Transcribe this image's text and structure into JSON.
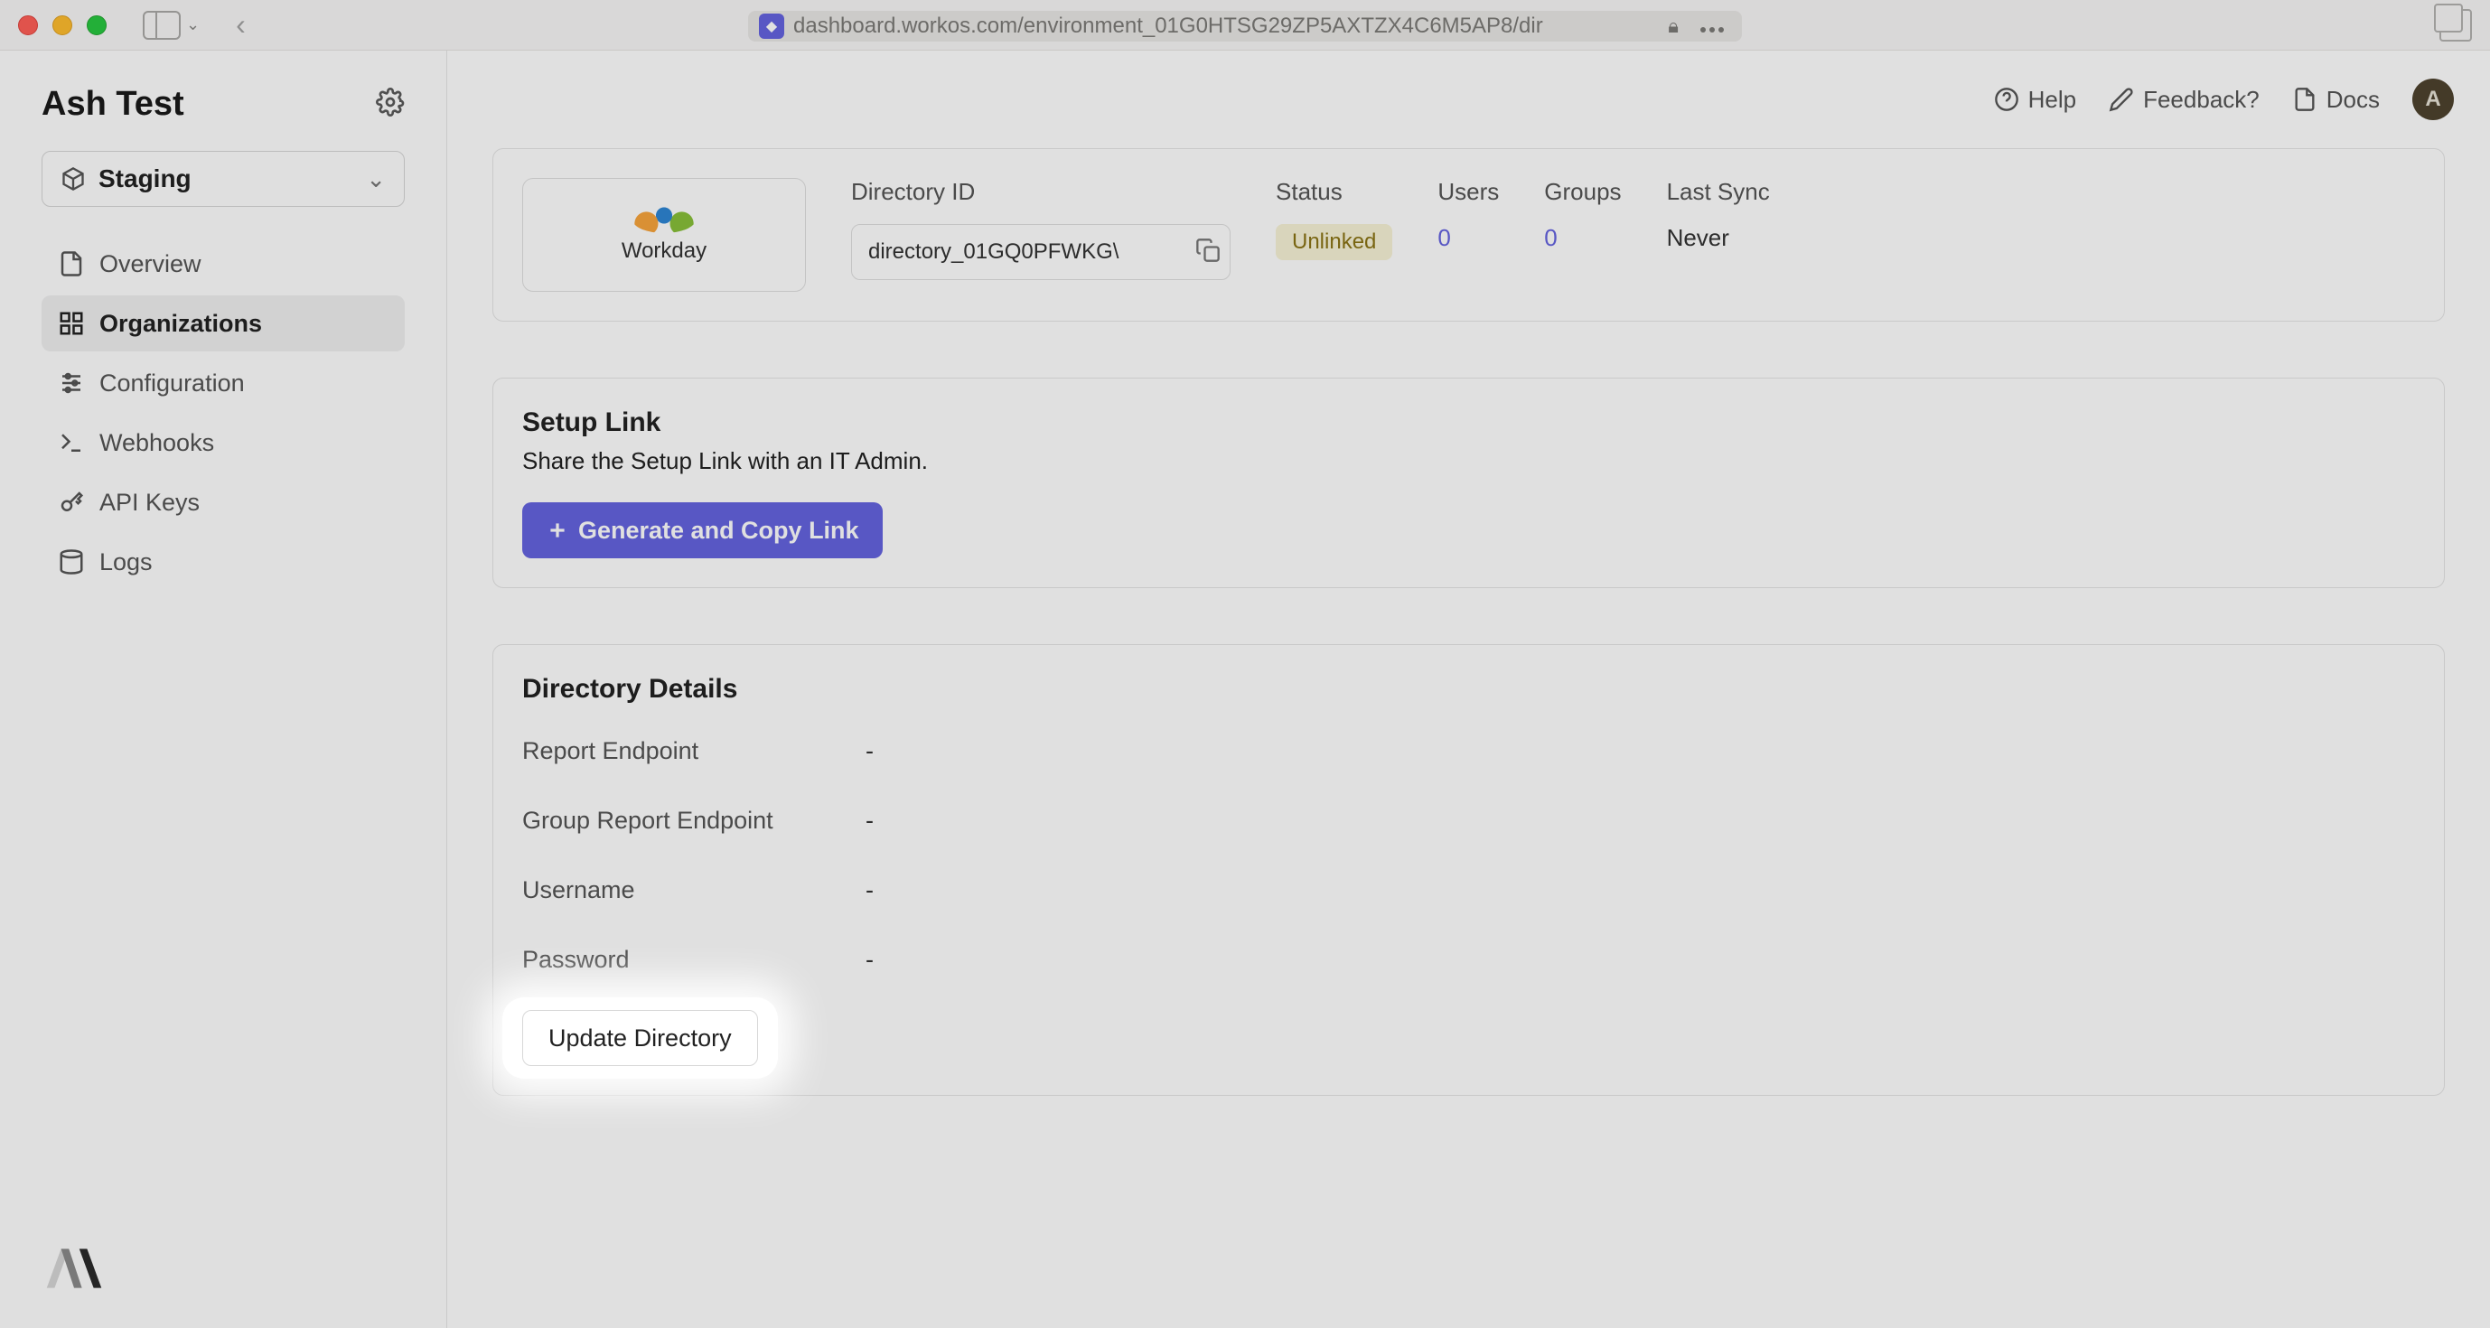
{
  "browser": {
    "url": "dashboard.workos.com/environment_01G0HTSG29ZP5AXTZX4C6M5AP8/dir"
  },
  "workspace": {
    "name": "Ash Test",
    "environment": "Staging"
  },
  "nav": {
    "overview": "Overview",
    "organizations": "Organizations",
    "configuration": "Configuration",
    "webhooks": "Webhooks",
    "api_keys": "API Keys",
    "logs": "Logs"
  },
  "topbar": {
    "help": "Help",
    "feedback": "Feedback?",
    "docs": "Docs",
    "avatar_initial": "A"
  },
  "directory": {
    "provider": "Workday",
    "id_label": "Directory ID",
    "id_value": "directory_01GQ0PFWKG\\",
    "status_label": "Status",
    "status_value": "Unlinked",
    "users_label": "Users",
    "users_value": "0",
    "groups_label": "Groups",
    "groups_value": "0",
    "last_sync_label": "Last Sync",
    "last_sync_value": "Never"
  },
  "setup": {
    "title": "Setup Link",
    "description": "Share the Setup Link with an IT Admin.",
    "button": "Generate and Copy Link"
  },
  "details": {
    "title": "Directory Details",
    "rows": [
      {
        "key": "Report Endpoint",
        "val": "-"
      },
      {
        "key": "Group Report Endpoint",
        "val": "-"
      },
      {
        "key": "Username",
        "val": "-"
      },
      {
        "key": "Password",
        "val": "-"
      }
    ],
    "update_button": "Update Directory"
  }
}
